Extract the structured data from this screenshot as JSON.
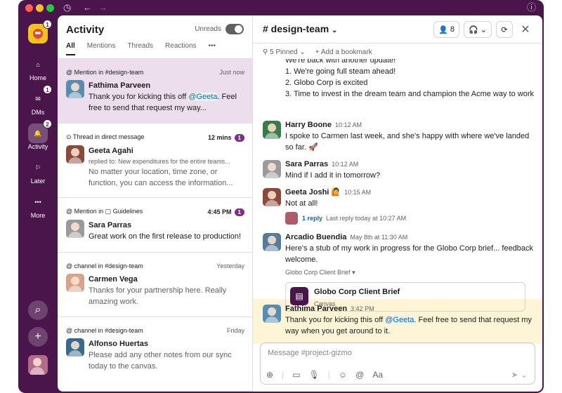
{
  "rail": {
    "items": [
      {
        "label": "Home"
      },
      {
        "label": "DMs",
        "badge": "1"
      },
      {
        "label": "Activity",
        "badge": "2"
      },
      {
        "label": "Later"
      },
      {
        "label": "More"
      }
    ],
    "workspace_badge": "1"
  },
  "panel": {
    "title": "Activity",
    "unreads_label": "Unreads",
    "tabs": [
      "All",
      "Mentions",
      "Threads",
      "Reactions",
      "•••"
    ],
    "items": [
      {
        "context": "Mention in #design-team",
        "time": "Just now",
        "name": "Fathima Parveen",
        "text_pre": "Thank you for kicking this off ",
        "mention": "@Geeta",
        "text_post": ". Feel free to send that request my way..."
      },
      {
        "context": "Thread in direct message",
        "time": "12 mins",
        "count": "1",
        "name": "Geeta Agahi",
        "sub": "replied to: New expenditures for the entire teams...",
        "text": "No matter your location, time zone, or function, you can access the information..."
      },
      {
        "context": "Mention in",
        "context_channel": "Guidelines",
        "time": "4:45 PM",
        "count": "1",
        "name": "Sara Parras",
        "text": "Great work on the first release to production!"
      },
      {
        "context": "channel in #design-team",
        "time": "Yesterday",
        "name": "Carmen Vega",
        "text": "Thanks for your partnership here. Really amazing work."
      },
      {
        "context": "channel in #design-team",
        "time": "Friday",
        "name": "Alfonso Huertas",
        "text": "Please add any other notes from our sync today to the canvas."
      }
    ]
  },
  "main": {
    "channel": "# design-team",
    "member_count": "8",
    "pinned": "5 Pinned",
    "add_bookmark": "Add a bookmark",
    "top_lines": [
      "We're back with another update!",
      "1. We're going full steam ahead!",
      "2. Globo Corp is excited",
      "3. Time to invest in the dream team and champion the Acme way to work"
    ],
    "messages": [
      {
        "name": "Harry Boone",
        "time": "10:12 AM",
        "text": "I spoke to Carmen last week, and she's happy with where we've landed so far. 🚀"
      },
      {
        "name": "Sara Parras",
        "time": "10:12 AM",
        "text": "Mind if I add it in tomorrow?"
      },
      {
        "name": "Geeta Joshi",
        "time": "10:15 AM",
        "text": "Not at all!",
        "replies": "1 reply",
        "last_reply": "Last reply today at 10:27 AM"
      },
      {
        "name": "Arcadio Buendia",
        "time": "May 8th at 11:30 AM",
        "text": "Here's a stub of my work in progress for the Globo Corp brief... feedback welcome.",
        "attachment_label": "Globo Corp Client Brief",
        "card_title": "Globo Corp Client Brief",
        "card_sub": "Canvas"
      },
      {
        "name": "Fathima Parveen",
        "time": "3:42 PM",
        "text_pre": "Thank you for kicking this off ",
        "mention": "@Geeta",
        "text_post": ". Feel free to send that request my way when you get around to it."
      }
    ],
    "composer_placeholder": "Message #project-gizmo"
  },
  "colors": {
    "aubergine": "#4a154b",
    "highlight": "#fdf5d6",
    "selected": "#ecdeec",
    "link": "#1264a3"
  }
}
